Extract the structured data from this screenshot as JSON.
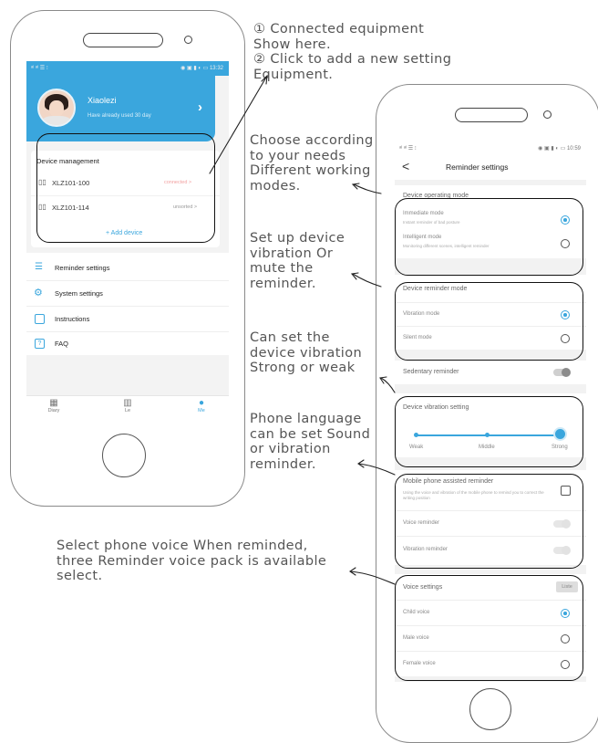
{
  "notes": {
    "connected": "① Connected equipment\nShow here.\n② Click to add a new setting\nEquipment.",
    "modes": "Choose according\nto your needs\nDifferent working\nmodes.",
    "vibration": "Set up device\nvibration Or\nmute the\nreminder.",
    "strength": "Can set the\ndevice vibration\nStrong or weak",
    "language": "Phone language\ncan be set Sound\nor vibration\nreminder.",
    "voice": "Select phone voice When reminded,\nthree Reminder voice pack is available\nselect."
  },
  "phone1": {
    "profile": {
      "name": "Xiaolezi",
      "subtitle": "Have already used 30  day"
    },
    "device_management": {
      "title": "Device management",
      "devices": [
        {
          "name": "XLZ101-100",
          "status": "connected >"
        },
        {
          "name": "XLZ101-114",
          "status": "unsorted >"
        }
      ],
      "add_label": "+ Add device"
    },
    "menu": [
      {
        "label": "Reminder settings",
        "icon": "list-icon"
      },
      {
        "label": "System settings",
        "icon": "gear-icon"
      },
      {
        "label": "Instructions",
        "icon": "document-icon"
      },
      {
        "label": "FAQ",
        "icon": "question-icon"
      }
    ],
    "tabs": [
      {
        "label": "Diary",
        "icon": "calendar-icon"
      },
      {
        "label": "Le",
        "icon": "chart-icon"
      },
      {
        "label": "Me",
        "icon": "person-icon"
      }
    ],
    "accent": "#3aa6dd"
  },
  "phone2": {
    "header": {
      "back": "<",
      "title": "Reminder settings"
    },
    "operating": {
      "title": "Device operating mode",
      "options": [
        {
          "label": "Immediate mode",
          "sub": "Instant reminder of bad posture",
          "selected": true
        },
        {
          "label": "Intelligent mode",
          "sub": "Monitoring different scenes, intelligent reminder",
          "selected": false
        }
      ]
    },
    "reminder_mode": {
      "title": "Device reminder mode",
      "options": [
        {
          "label": "Vibration mode",
          "selected": true
        },
        {
          "label": "Silent mode",
          "selected": false
        }
      ]
    },
    "sedentary": {
      "label": "Sedentary reminder",
      "on": false
    },
    "vibration_setting": {
      "title": "Device vibration setting",
      "levels": [
        "Weak",
        "Middle",
        "Strong"
      ],
      "selected_level": "Strong"
    },
    "assisted": {
      "title": "Mobile phone assisted reminder",
      "desc": "Using the voice and vibration of the mobile phone to remind you to correct the writing position",
      "items": [
        {
          "label": "Voice reminder"
        },
        {
          "label": "Vibration reminder"
        }
      ]
    },
    "voice": {
      "title": "Voice settings",
      "listen": "Liste",
      "options": [
        {
          "label": "Child voice",
          "selected": true
        },
        {
          "label": "Male voice",
          "selected": false
        },
        {
          "label": "Female voice",
          "selected": false
        }
      ]
    }
  }
}
